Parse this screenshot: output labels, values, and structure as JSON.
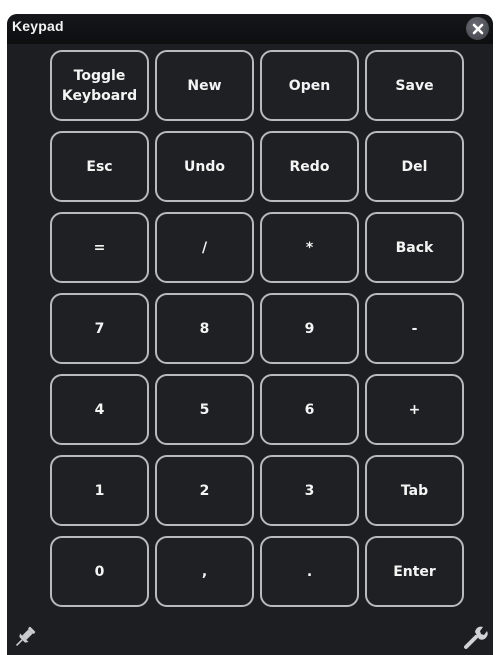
{
  "window": {
    "title": "Keypad"
  },
  "keys": [
    [
      {
        "label": "Toggle\nKeyboard",
        "name": "toggle-keyboard-key"
      },
      {
        "label": "New",
        "name": "new-key"
      },
      {
        "label": "Open",
        "name": "open-key"
      },
      {
        "label": "Save",
        "name": "save-key"
      }
    ],
    [
      {
        "label": "Esc",
        "name": "esc-key"
      },
      {
        "label": "Undo",
        "name": "undo-key"
      },
      {
        "label": "Redo",
        "name": "redo-key"
      },
      {
        "label": "Del",
        "name": "del-key"
      }
    ],
    [
      {
        "label": "=",
        "name": "equals-key"
      },
      {
        "label": "/",
        "name": "divide-key"
      },
      {
        "label": "*",
        "name": "multiply-key"
      },
      {
        "label": "Back",
        "name": "back-key"
      }
    ],
    [
      {
        "label": "7",
        "name": "key-7"
      },
      {
        "label": "8",
        "name": "key-8"
      },
      {
        "label": "9",
        "name": "key-9"
      },
      {
        "label": "-",
        "name": "minus-key"
      }
    ],
    [
      {
        "label": "4",
        "name": "key-4"
      },
      {
        "label": "5",
        "name": "key-5"
      },
      {
        "label": "6",
        "name": "key-6"
      },
      {
        "label": "+",
        "name": "plus-key"
      }
    ],
    [
      {
        "label": "1",
        "name": "key-1"
      },
      {
        "label": "2",
        "name": "key-2"
      },
      {
        "label": "3",
        "name": "key-3"
      },
      {
        "label": "Tab",
        "name": "tab-key"
      }
    ],
    [
      {
        "label": "0",
        "name": "key-0"
      },
      {
        "label": ",",
        "name": "comma-key"
      },
      {
        "label": ".",
        "name": "period-key"
      },
      {
        "label": "Enter",
        "name": "enter-key"
      }
    ]
  ],
  "icons": {
    "close": "close-icon",
    "pin": "pin-icon",
    "settings": "wrench-icon"
  },
  "colors": {
    "window_bg": "#1d1e21",
    "titlebar_bg": "#0d0e10",
    "key_border": "#b8babd",
    "key_text": "#f4f4f4"
  }
}
